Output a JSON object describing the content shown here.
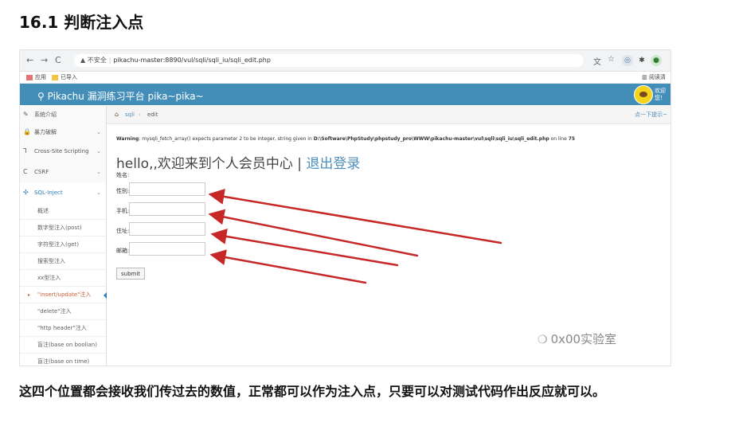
{
  "heading": "16.1 判断注入点",
  "browser": {
    "back": "←",
    "forward": "→",
    "reload": "C",
    "security_warning": "▲ 不安全",
    "url": "pikachu-master:8890/vul/sqli/sqli_iu/sqli_edit.php",
    "bookmarks": [
      "应用",
      "已导入"
    ],
    "reading_list": "阅读清"
  },
  "app": {
    "brand": "Pikachu 漏洞练习平台 pika~pika~",
    "user_line1": "欢迎",
    "user_line2": "您！"
  },
  "sidebar": {
    "items": [
      {
        "icon": "✎",
        "label": "系统介绍",
        "chevron": ""
      },
      {
        "icon": "🔒",
        "label": "暴力破解",
        "chevron": "⌄"
      },
      {
        "icon": "⅂",
        "label": "Cross-Site Scripting",
        "chevron": "⌄"
      },
      {
        "icon": "C",
        "label": "CSRF",
        "chevron": "⌄"
      },
      {
        "icon": "✣",
        "label": "SQL-Inject",
        "chevron": "⌄"
      }
    ],
    "sub_items": [
      "概述",
      "数字型注入(post)",
      "字符型注入(get)",
      "搜索型注入",
      "xx型注入",
      "\"insert/update\"注入",
      "\"delete\"注入",
      "\"http header\"注入",
      "盲注(base on boolian)",
      "盲注(base on time)"
    ]
  },
  "breadcrumbs": {
    "crumb1": "sqli",
    "separator": "›",
    "crumb2": "edit",
    "hint": "点一下提示~"
  },
  "warning": {
    "label": "Warning",
    "message": ": mysqli_fetch_array() expects parameter 2 to be integer, string given in ",
    "path": "D:\\Software\\PhpStudy\\phpstudy_pro\\WWW\\pikachu-master\\vul\\sqli\\sqli_iu\\sqli_edit.php",
    "on_line": " on line ",
    "line": "75"
  },
  "main": {
    "hello": "hello,,欢迎来到个人会员中心 | ",
    "logout": "退出登录",
    "name_label": "姓名:",
    "fields": [
      {
        "label": "性别:",
        "value": ""
      },
      {
        "label": "手机:",
        "value": ""
      },
      {
        "label": "住址:",
        "value": ""
      },
      {
        "label": "邮箱:",
        "value": ""
      }
    ],
    "submit": "submit"
  },
  "colors": {
    "header": "#438eb9",
    "arrows": "#c62828",
    "link": "#4c8fbd"
  },
  "watermark": "0x00实验室",
  "caption": "这四个位置都会接收我们传过去的数值，正常都可以作为注入点，只要可以对测试代码作出反应就可以。"
}
